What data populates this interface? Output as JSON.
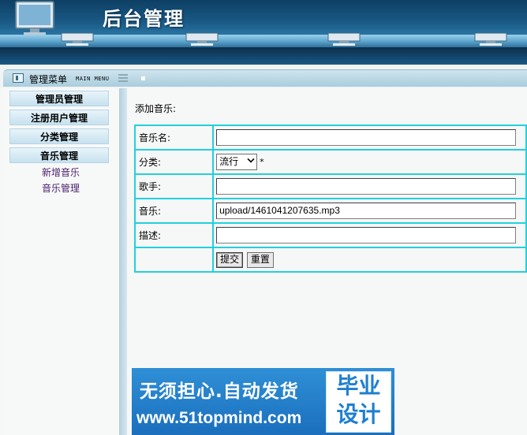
{
  "header": {
    "title": "后台管理"
  },
  "menu": {
    "title": "管理菜单",
    "subtitle": "MAIN MENU"
  },
  "sidebar": {
    "groups": [
      {
        "label": "管理员管理"
      },
      {
        "label": "注册用户管理"
      },
      {
        "label": "分类管理"
      },
      {
        "label": "音乐管理"
      }
    ],
    "links": [
      {
        "label": "新增音乐"
      },
      {
        "label": "音乐管理"
      }
    ]
  },
  "form": {
    "title": "添加音乐:",
    "fields": {
      "name_label": "音乐名:",
      "name_value": "",
      "category_label": "分类:",
      "category_value": "流行",
      "required_mark": "*",
      "singer_label": "歌手:",
      "singer_value": "",
      "music_label": "音乐:",
      "music_value": "upload/1461041207635.mp3",
      "desc_label": "描述:",
      "desc_value": ""
    },
    "submit_label": "提交",
    "reset_label": "重置"
  },
  "ad": {
    "line1": "无须担心.自动发货",
    "line2": "www.51topmind.com",
    "right_line1": "毕业",
    "right_line2": "设计"
  }
}
